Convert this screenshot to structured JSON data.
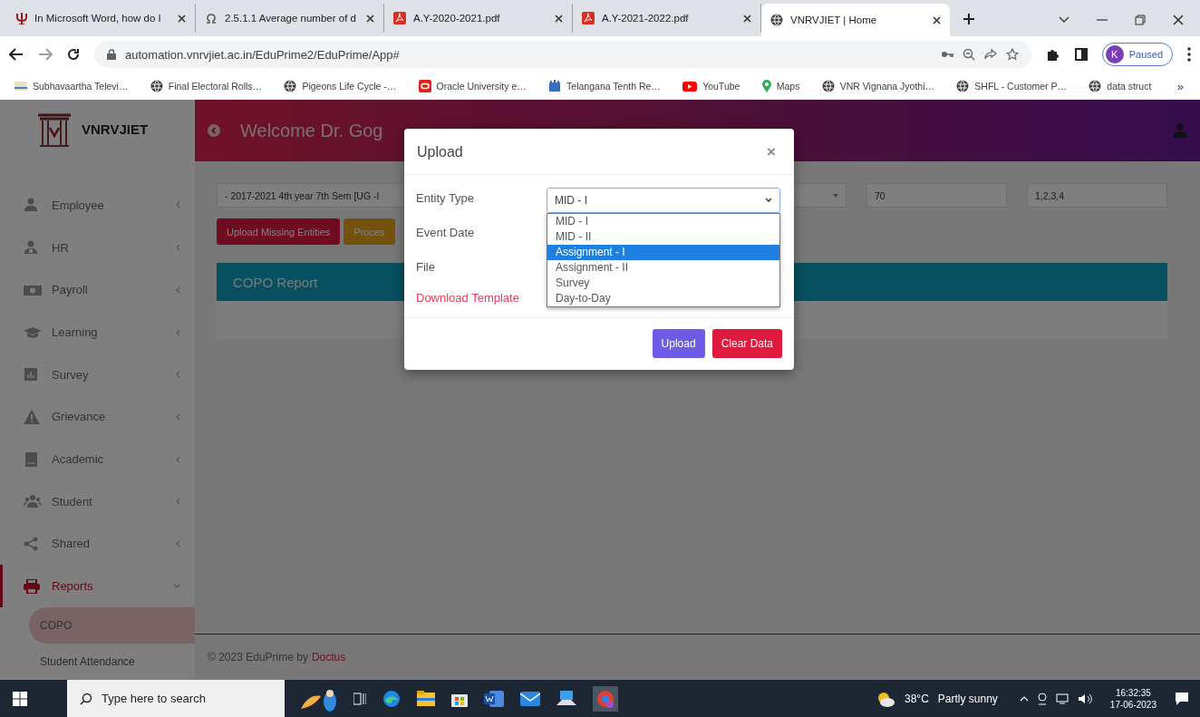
{
  "browser": {
    "tabs": [
      {
        "title": "In Microsoft Word, how do I",
        "selected": false
      },
      {
        "title": "2.5.1.1 Average number of d",
        "selected": false
      },
      {
        "title": "A.Y-2020-2021.pdf",
        "selected": false
      },
      {
        "title": "A.Y-2021-2022.pdf",
        "selected": false
      },
      {
        "title": "VNRVJIET | Home",
        "selected": true
      }
    ],
    "address": "automation.vnrvjiet.ac.in/EduPrime2/EduPrime/App#",
    "profile": {
      "initial": "K",
      "status": "Paused"
    },
    "bookmarks": [
      {
        "label": "Subhavaartha Televi…"
      },
      {
        "label": "Final Electoral Rolls…"
      },
      {
        "label": "Pigeons Life Cycle -…"
      },
      {
        "label": "Oracle University e…"
      },
      {
        "label": "Telangana Tenth Re…"
      },
      {
        "label": "YouTube"
      },
      {
        "label": "Maps"
      },
      {
        "label": "VNR Vignana Jyothi…"
      },
      {
        "label": "SHFL - Customer P…"
      },
      {
        "label": "data struct"
      }
    ],
    "bookmarks_more": "»"
  },
  "app": {
    "brand": "VNRVJIET",
    "welcome": "Welcome Dr. Gog",
    "sidebar": {
      "items": [
        {
          "label": "Employee",
          "expanded": false,
          "selected": false
        },
        {
          "label": "HR",
          "expanded": false,
          "selected": false
        },
        {
          "label": "Payroll",
          "expanded": false,
          "selected": false
        },
        {
          "label": "Learning",
          "expanded": false,
          "selected": false
        },
        {
          "label": "Survey",
          "expanded": false,
          "selected": false
        },
        {
          "label": "Grievance",
          "expanded": false,
          "selected": false
        },
        {
          "label": "Academic",
          "expanded": false,
          "selected": false
        },
        {
          "label": "Student",
          "expanded": false,
          "selected": false
        },
        {
          "label": "Shared",
          "expanded": false,
          "selected": false
        },
        {
          "label": "Reports",
          "expanded": true,
          "selected": true,
          "children": [
            {
              "label": "COPO",
              "selected": true
            },
            {
              "label": "Student Attendance",
              "selected": false
            }
          ]
        }
      ]
    },
    "filters": [
      {
        "kind": "select",
        "value": "- 2017-2021 4th year 7th Sem [UG -I"
      },
      {
        "kind": "select"
      },
      {
        "kind": "input",
        "value": "70"
      },
      {
        "kind": "input",
        "value": "1,2,3,4"
      }
    ],
    "actions": [
      {
        "label": "Upload Missing Entities",
        "kind": "danger"
      },
      {
        "label": "Proces",
        "kind": "warning"
      }
    ],
    "panel": {
      "title": "COPO Report"
    },
    "footer": {
      "text": "© 2023 EduPrime by",
      "link": "Doctus"
    },
    "modal": {
      "title": "Upload",
      "close": "×",
      "fields": [
        {
          "label": "Entity Type"
        },
        {
          "label": "Event Date"
        },
        {
          "label": "File"
        }
      ],
      "entity_select": {
        "value": "MID - I",
        "options": [
          {
            "label": "MID - I",
            "highlighted": false
          },
          {
            "label": "MID - II",
            "highlighted": false
          },
          {
            "label": "Assignment - I",
            "highlighted": true
          },
          {
            "label": "Assignment - II",
            "highlighted": false
          },
          {
            "label": "Survey",
            "highlighted": false
          },
          {
            "label": "Day-to-Day",
            "highlighted": false
          }
        ]
      },
      "template_link": "Download Template",
      "buttons": [
        {
          "label": "Upload",
          "kind": "primary"
        },
        {
          "label": "Clear Data",
          "kind": "danger"
        }
      ]
    }
  },
  "taskbar": {
    "search_placeholder": "Type here to search",
    "weather": {
      "temp": "38°C",
      "text": "Partly sunny"
    },
    "time": "16:32:35",
    "date": "17-06-2023"
  }
}
